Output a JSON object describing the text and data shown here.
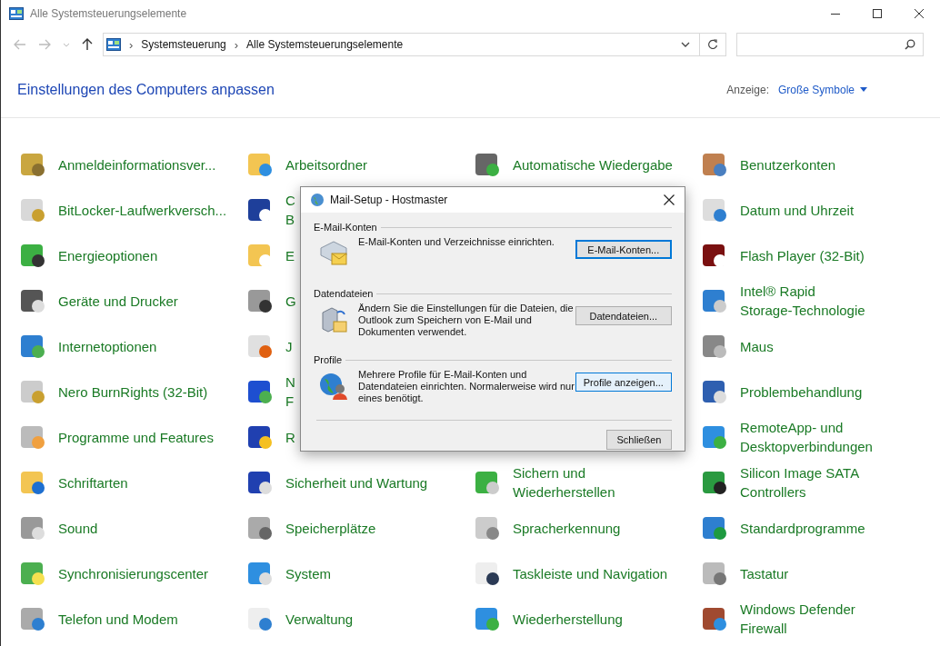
{
  "window": {
    "title": "Alle Systemsteuerungselemente"
  },
  "address_bar": {
    "path": [
      "Systemsteuerung",
      "Alle Systemsteuerungselemente"
    ],
    "separator": "›"
  },
  "header": {
    "title": "Einstellungen des Computers anpassen",
    "view_label": "Anzeige:",
    "view_value": "Große Symbole"
  },
  "columns": [
    [
      {
        "lines": [
          "Anmeldeinformationsver..."
        ]
      },
      {
        "lines": [
          "BitLocker-Laufwerkversch..."
        ]
      },
      {
        "lines": [
          "Energieoptionen"
        ]
      },
      {
        "lines": [
          "Geräte und Drucker"
        ]
      },
      {
        "lines": [
          "Internetoptionen"
        ]
      },
      {
        "lines": [
          "Nero BurnRights (32-Bit)"
        ]
      },
      {
        "lines": [
          "Programme und Features"
        ]
      },
      {
        "lines": [
          "Schriftarten"
        ]
      },
      {
        "lines": [
          "Sound"
        ]
      },
      {
        "lines": [
          "Synchronisierungscenter"
        ]
      },
      {
        "lines": [
          "Telefon und Modem"
        ]
      }
    ],
    [
      {
        "lines": [
          "Arbeitsordner"
        ]
      },
      {
        "lines": [
          "C",
          "B"
        ]
      },
      {
        "lines": [
          "E"
        ]
      },
      {
        "lines": [
          "G"
        ]
      },
      {
        "lines": [
          "J"
        ]
      },
      {
        "lines": [
          "N",
          "F"
        ]
      },
      {
        "lines": [
          "R"
        ]
      },
      {
        "lines": [
          "Sicherheit und Wartung"
        ]
      },
      {
        "lines": [
          "Speicherplätze"
        ]
      },
      {
        "lines": [
          "System"
        ]
      },
      {
        "lines": [
          "Verwaltung"
        ]
      }
    ],
    [
      {
        "lines": [
          "Automatische Wiedergabe"
        ]
      },
      {
        "lines": [
          "Sichern und",
          "Wiederherstellen"
        ]
      },
      {
        "lines": [
          "Spracherkennung"
        ]
      },
      {
        "lines": [
          "Taskleiste und Navigation"
        ]
      },
      {
        "lines": [
          "Wiederherstellung"
        ]
      }
    ],
    [
      {
        "lines": [
          "Benutzerkonten"
        ]
      },
      {
        "lines": [
          "Datum und Uhrzeit"
        ]
      },
      {
        "lines": [
          "Flash Player (32-Bit)"
        ]
      },
      {
        "lines": [
          "Intel® Rapid",
          "Storage-Technologie"
        ]
      },
      {
        "lines": [
          "Maus"
        ]
      },
      {
        "lines": [
          "Problembehandlung"
        ]
      },
      {
        "lines": [
          "RemoteApp- und",
          "Desktopverbindungen"
        ]
      },
      {
        "lines": [
          "Silicon Image SATA",
          "Controllers"
        ]
      },
      {
        "lines": [
          "Standardprogramme"
        ]
      },
      {
        "lines": [
          "Tastatur"
        ]
      },
      {
        "lines": [
          "Windows Defender",
          "Firewall"
        ]
      }
    ]
  ],
  "dialog": {
    "title": "Mail-Setup - Hostmaster",
    "sections": [
      {
        "heading": "E-Mail-Konten",
        "description": "E-Mail-Konten und Verzeichnisse einrichten.",
        "button": "E-Mail-Konten...",
        "focused": true,
        "hovered": false
      },
      {
        "heading": "Datendateien",
        "description": "Ändern Sie die Einstellungen für die Dateien, die Outlook zum Speichern von E-Mail und Dokumenten verwendet.",
        "button": "Datendateien...",
        "focused": false,
        "hovered": false
      },
      {
        "heading": "Profile",
        "description": "Mehrere Profile für E-Mail-Konten und Datendateien einrichten. Normalerweise wird nur eines benötigt.",
        "button": "Profile anzeigen...",
        "focused": false,
        "hovered": true
      }
    ],
    "close_button": "Schließen"
  }
}
